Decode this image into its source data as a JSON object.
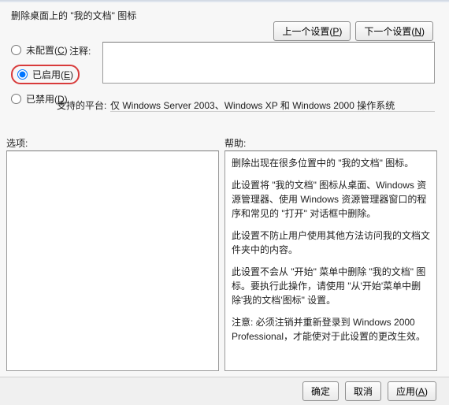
{
  "title": "删除桌面上的 \"我的文档\" 图标",
  "nav": {
    "prev": "上一个设置(",
    "prev_u": "P",
    "prev_end": ")",
    "next": "下一个设置(",
    "next_u": "N",
    "next_end": ")"
  },
  "radios": {
    "unconfigured": {
      "pre": "未配置(",
      "u": "C",
      "end": ")"
    },
    "enabled": {
      "pre": "已启用(",
      "u": "E",
      "end": ")"
    },
    "disabled": {
      "pre": "已禁用(",
      "u": "D",
      "end": ")"
    }
  },
  "labels": {
    "comment": "注释:",
    "platform": "支持的平台:",
    "options": "选项:",
    "help": "帮助:"
  },
  "platform_value": "仅 Windows Server 2003、Windows XP 和 Windows 2000 操作系统",
  "help_paras": [
    "删除出现在很多位置中的 \"我的文档\" 图标。",
    "此设置将 \"我的文档\" 图标从桌面、Windows 资源管理器、使用 Windows 资源管理器窗口的程序和常见的 \"打开\" 对话框中删除。",
    "此设置不防止用户使用其他方法访问我的文档文件夹中的内容。",
    "此设置不会从 \"开始\" 菜单中删除 \"我的文档\" 图标。要执行此操作，请使用 \"从'开始'菜单中删除'我的文档'图标\" 设置。",
    "注意: 必须注销并重新登录到 Windows 2000 Professional，才能使对于此设置的更改生效。"
  ],
  "footer": {
    "ok": "确定",
    "cancel": "取消",
    "apply": {
      "pre": "应用(",
      "u": "A",
      "end": ")"
    }
  }
}
